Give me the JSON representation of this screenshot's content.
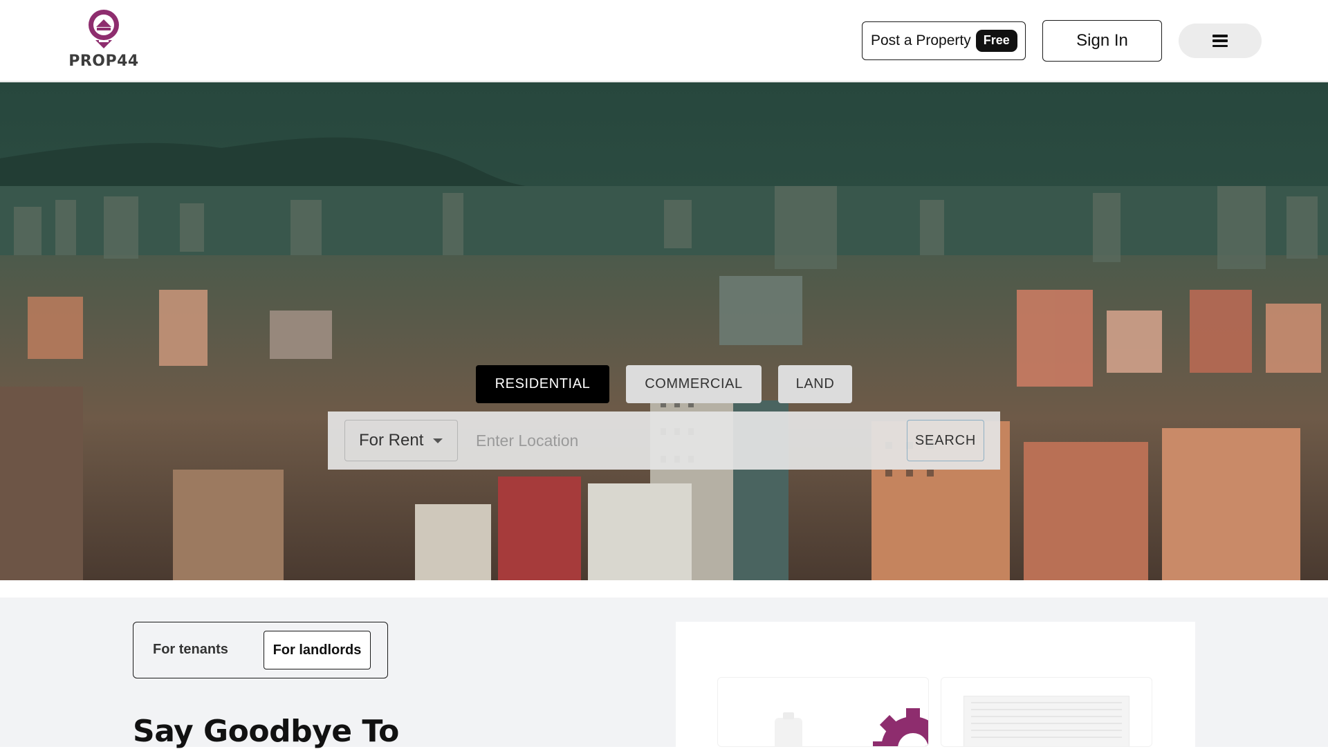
{
  "header": {
    "logo_text": "PROP44",
    "post_property_label": "Post a Property",
    "post_property_badge": "Free",
    "sign_in_label": "Sign In",
    "menu_icon": "hamburger-icon"
  },
  "hero": {
    "tabs": [
      {
        "label": "RESIDENTIAL",
        "active": true
      },
      {
        "label": "COMMERCIAL",
        "active": false
      },
      {
        "label": "LAND",
        "active": false
      }
    ],
    "search": {
      "mode_selected": "For Rent",
      "location_placeholder": "Enter Location",
      "search_label": "SEARCH"
    }
  },
  "audience_toggle": {
    "options": [
      {
        "label": "For tenants",
        "selected": false
      },
      {
        "label": "For landlords",
        "selected": true
      }
    ]
  },
  "section": {
    "headline": "Say Goodbye To"
  },
  "colors": {
    "brand": "#8e2d6e",
    "primary": "#000000",
    "accent_border": "#8fb0c4"
  }
}
